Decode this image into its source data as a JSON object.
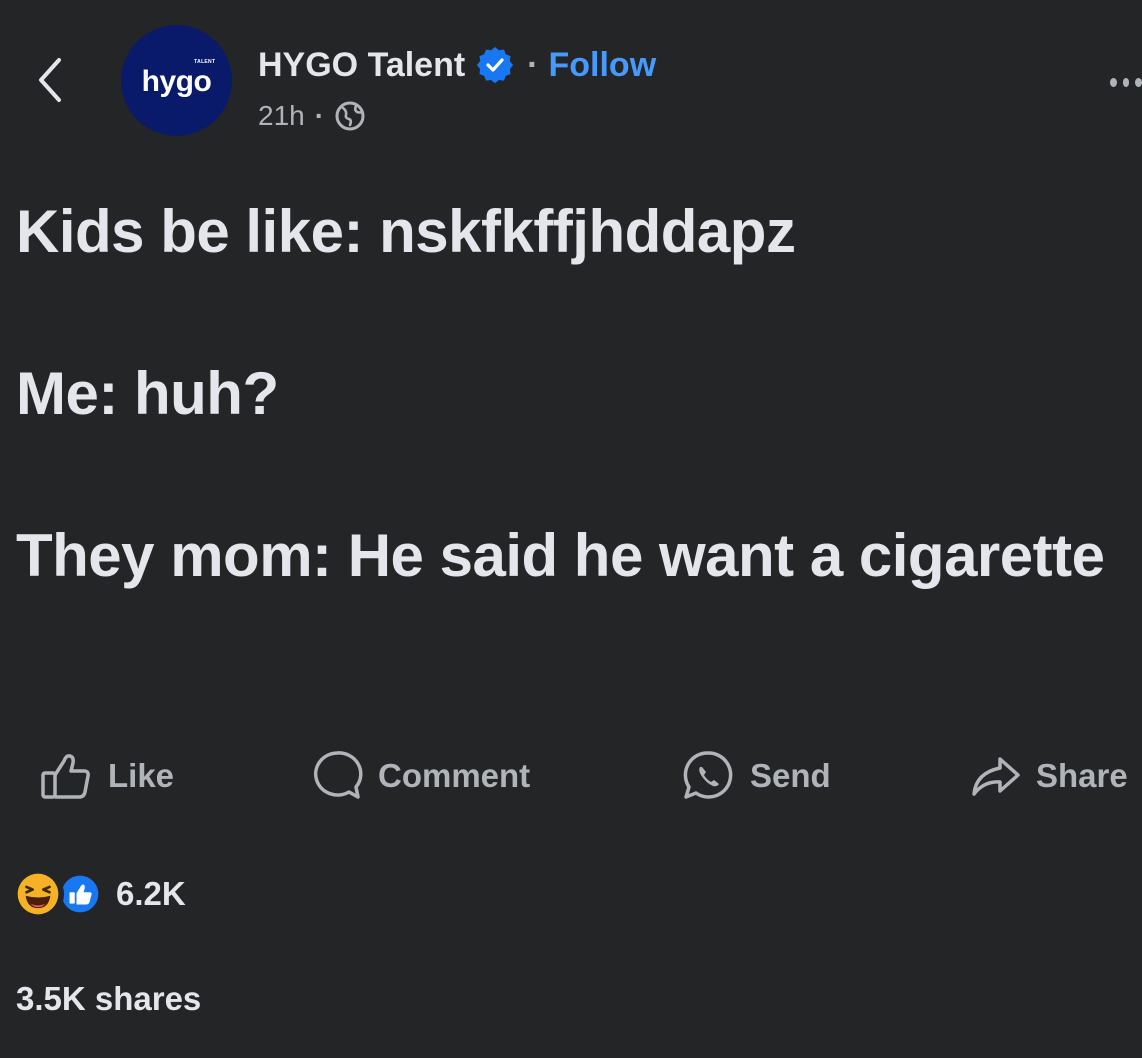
{
  "header": {
    "avatar_logo": "hygo",
    "avatar_tag": "TALENT",
    "page_name": "HYGO Talent",
    "separator": "·",
    "follow_label": "Follow",
    "timestamp": "21h",
    "meta_separator": "·"
  },
  "post": {
    "lines": [
      "Kids be like: nskfkffjhddapz",
      "Me: huh?",
      "They mom: He said he want a cigarette"
    ]
  },
  "actions": {
    "like": "Like",
    "comment": "Comment",
    "send": "Send",
    "share": "Share"
  },
  "reactions": {
    "types": [
      "haha",
      "like"
    ],
    "count": "6.2K"
  },
  "shares": {
    "label": "3.5K shares"
  },
  "colors": {
    "background": "#242526",
    "text_primary": "#e4e6eb",
    "text_secondary": "#b0b3b8",
    "link_blue": "#4599ff",
    "verified_blue": "#1877f2",
    "avatar_bg": "#0a1a6b"
  },
  "icons": {
    "back": "chevron-left-icon",
    "verified": "verified-badge-icon",
    "globe": "globe-icon",
    "more": "more-options-icon",
    "like": "thumbs-up-icon",
    "comment": "comment-bubble-icon",
    "send": "messenger-send-icon",
    "share": "share-arrow-icon"
  }
}
